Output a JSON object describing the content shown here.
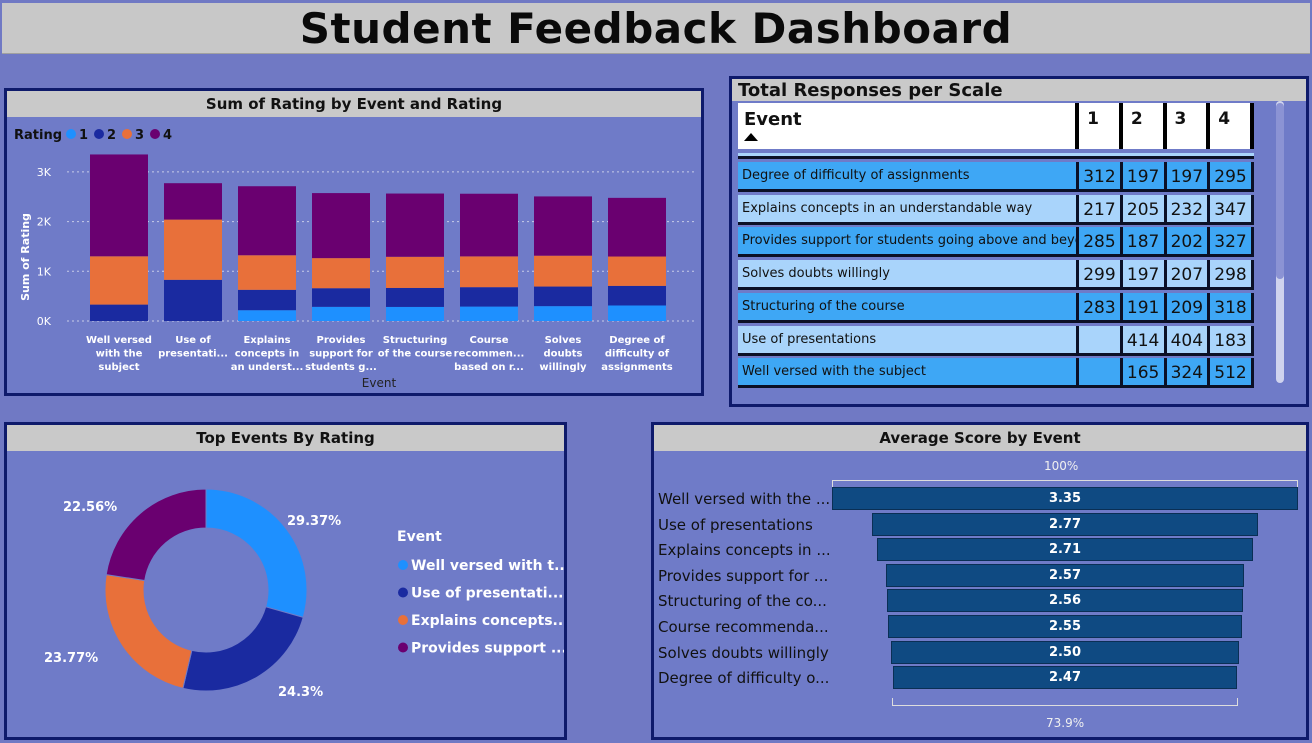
{
  "dashboard": {
    "title": "Student Feedback Dashboard"
  },
  "colors": {
    "r1": "#1e90ff",
    "r2": "#1a2aa0",
    "r3": "#e8703a",
    "r4": "#6a0070",
    "barDark": "#0f4a82"
  },
  "bar_panel": {
    "title": "Sum of Rating by Event and Rating",
    "legend_title": "Rating",
    "legend": [
      "1",
      "2",
      "3",
      "4"
    ]
  },
  "table_panel": {
    "title": "Total Responses per Scale",
    "columns": [
      "Event",
      "1",
      "2",
      "3",
      "4"
    ],
    "rows": [
      {
        "event": "Degree of difficulty of assignments",
        "v1": "312",
        "v2": "197",
        "v3": "197",
        "v4": "295"
      },
      {
        "event": "Explains concepts in an understandable way",
        "v1": "217",
        "v2": "205",
        "v3": "232",
        "v4": "347"
      },
      {
        "event": "Provides support for students going above and beyond",
        "v1": "285",
        "v2": "187",
        "v3": "202",
        "v4": "327"
      },
      {
        "event": "Solves doubts willingly",
        "v1": "299",
        "v2": "197",
        "v3": "207",
        "v4": "298"
      },
      {
        "event": "Structuring of the course",
        "v1": "283",
        "v2": "191",
        "v3": "209",
        "v4": "318"
      },
      {
        "event": "Use of presentations",
        "v1": "",
        "v2": "414",
        "v3": "404",
        "v4": "183"
      },
      {
        "event": "Well versed with the subject",
        "v1": "",
        "v2": "165",
        "v3": "324",
        "v4": "512"
      }
    ]
  },
  "donut_panel": {
    "title": "Top Events By Rating",
    "legend_title": "Event",
    "legend": [
      "Well versed with t...",
      "Use of presentati...",
      "Explains concepts...",
      "Provides support ..."
    ],
    "labels": [
      "29.37%",
      "24.3%",
      "23.77%",
      "22.56%"
    ]
  },
  "funnel_panel": {
    "title": "Average Score by Event",
    "top_label": "100%",
    "bottom_label": "73.9%",
    "labels": [
      "Well versed with the ...",
      "Use of presentations",
      "Explains concepts in ...",
      "Provides support for ...",
      "Structuring of the co...",
      "Course recommenda...",
      "Solves doubts willingly",
      "Degree of difficulty o..."
    ],
    "values": [
      "3.35",
      "2.77",
      "2.71",
      "2.57",
      "2.56",
      "2.55",
      "2.50",
      "2.47"
    ]
  },
  "chart_data": [
    {
      "type": "bar",
      "stacked": true,
      "title": "Sum of Rating by Event and Rating",
      "xlabel": "Event",
      "ylabel": "Sum of Rating",
      "ylim": [
        0,
        3500
      ],
      "yticks": [
        "0K",
        "1K",
        "2K",
        "3K"
      ],
      "categories": [
        [
          "Well versed",
          "with the",
          "subject"
        ],
        [
          "Use of",
          "presentati..."
        ],
        [
          "Explains",
          "concepts in",
          "an underst..."
        ],
        [
          "Provides",
          "support for",
          "students g..."
        ],
        [
          "Structuring",
          "of the course"
        ],
        [
          "Course",
          "recommen...",
          "based on r..."
        ],
        [
          "Solves",
          "doubts",
          "willingly"
        ],
        [
          "Degree of",
          "difficulty of",
          "assignments"
        ]
      ],
      "series": [
        {
          "name": "1",
          "color": "#1e90ff",
          "values": [
            0,
            0,
            217,
            285,
            283,
            290,
            299,
            312
          ]
        },
        {
          "name": "2",
          "color": "#1a2aa0",
          "values": [
            330,
            828,
            410,
            374,
            382,
            390,
            394,
            394
          ]
        },
        {
          "name": "3",
          "color": "#e8703a",
          "values": [
            972,
            1212,
            696,
            606,
            627,
            620,
            621,
            591
          ]
        },
        {
          "name": "4",
          "color": "#6a0070",
          "values": [
            2048,
            732,
            1388,
            1308,
            1272,
            1260,
            1192,
            1180
          ]
        }
      ],
      "grid": true,
      "legend_position": "top-left"
    },
    {
      "type": "pie",
      "title": "Top Events By Rating",
      "labels": [
        "Well versed with t...",
        "Use of presentati...",
        "Explains concepts...",
        "Provides support ..."
      ],
      "values": [
        29.37,
        24.3,
        23.77,
        22.56
      ],
      "colors": [
        "#1e90ff",
        "#1a2aa0",
        "#e8703a",
        "#6a0070"
      ],
      "donut": true,
      "legend_position": "right"
    },
    {
      "type": "bar",
      "orientation": "funnel",
      "title": "Average Score by Event",
      "categories": [
        "Well versed with the ...",
        "Use of presentations",
        "Explains concepts in ...",
        "Provides support for ...",
        "Structuring of the co...",
        "Course recommenda...",
        "Solves doubts willingly",
        "Degree of difficulty o..."
      ],
      "values": [
        3.35,
        2.77,
        2.71,
        2.57,
        2.56,
        2.55,
        2.5,
        2.47
      ]
    }
  ]
}
